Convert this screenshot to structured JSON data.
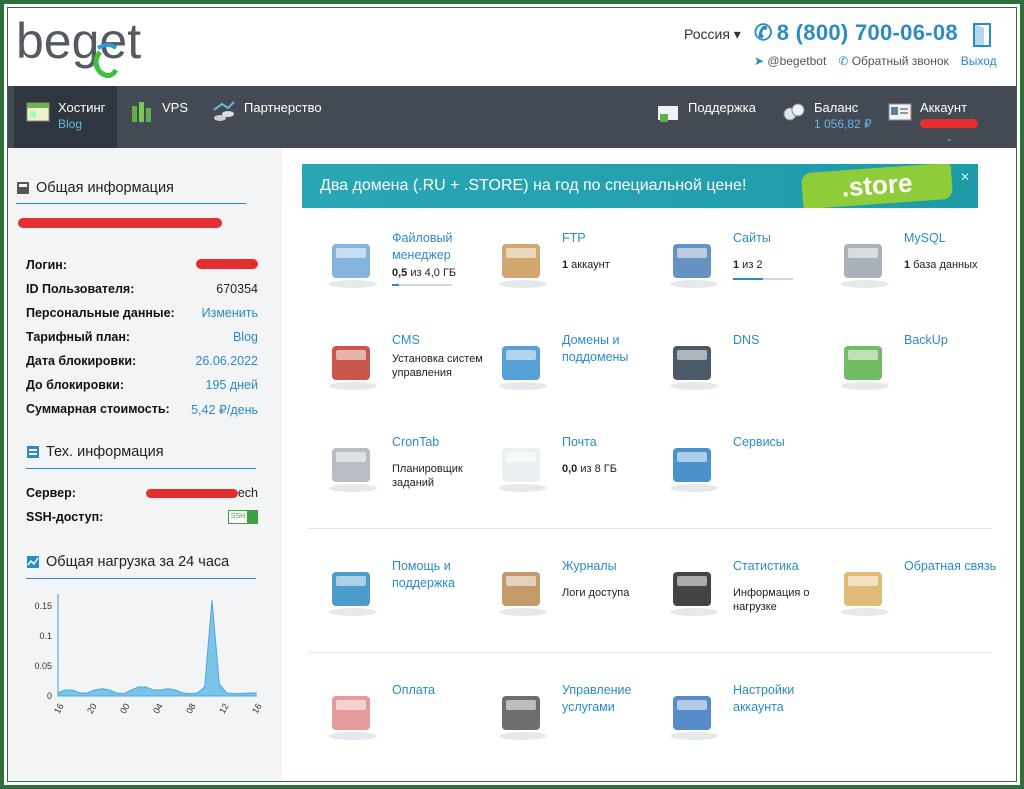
{
  "header": {
    "logo_text": "beget",
    "region": "Россия ▾",
    "phone": "8 (800) 700-06-08",
    "telegram": "@begetbot",
    "callback": "Обратный звонок",
    "exit": "Выход"
  },
  "nav": {
    "hosting": "Хостинг",
    "hosting_sub": "Blog",
    "vps": "VPS",
    "partner": "Партнерство",
    "support": "Поддержка",
    "balance": "Баланс",
    "balance_value": "1 056,82 ₽",
    "account": "Аккаунт"
  },
  "sidebar": {
    "general_title": "Общая информация",
    "rows": [
      {
        "k": "Логин:",
        "v": ""
      },
      {
        "k": "ID Пользователя:",
        "v": "670354"
      },
      {
        "k": "Персональные данные:",
        "v": "Изменить"
      },
      {
        "k": "Тарифный план:",
        "v": "Blog"
      },
      {
        "k": "Дата блокировки:",
        "v": "26.06.2022"
      },
      {
        "k": "До блокировки:",
        "v": "195 дней"
      },
      {
        "k": "Суммарная стоимость:",
        "v": "5,42 ₽/день"
      }
    ],
    "tech_title": "Тех. информация",
    "server_label": "Сервер:",
    "server_suffix": "ech",
    "ssh_label": "SSH-доступ:",
    "ssh_badge": "SSH",
    "load_title": "Общая нагрузка за 24 часа"
  },
  "chart_data": {
    "type": "area",
    "title": "Общая нагрузка за 24 часа",
    "x_ticks": [
      "16",
      "20",
      "00",
      "04",
      "08",
      "12",
      "16"
    ],
    "y_ticks": [
      "0.15",
      "0.1",
      "0.05",
      "0"
    ],
    "ylim": [
      0,
      0.17
    ],
    "values": [
      0.005,
      0.01,
      0.01,
      0.005,
      0.005,
      0.01,
      0.012,
      0.01,
      0.005,
      0.004,
      0.01,
      0.015,
      0.015,
      0.01,
      0.01,
      0.012,
      0.01,
      0.005,
      0.004,
      0.005,
      0.015,
      0.16,
      0.02,
      0.005,
      0.004,
      0.004,
      0.005,
      0.005
    ],
    "color": "#7ac4e8"
  },
  "banner": {
    "text": "Два домена (.RU + .STORE) на год по специальной цене!",
    "store": ".store",
    "close": "✕"
  },
  "tiles": [
    {
      "title": "Файловый менеджер",
      "desc_bold": "0,5",
      "desc": " из 4,0 ГБ",
      "icon": "file-manager-icon"
    },
    {
      "title": "FTP",
      "desc_bold": "1",
      "desc": " аккаунт",
      "icon": "ftp-icon"
    },
    {
      "title": "Сайты",
      "desc_bold": "1",
      "desc": " из 2",
      "icon": "sites-icon"
    },
    {
      "title": "MySQL",
      "desc_bold": "1",
      "desc": " база данных",
      "icon": "mysql-icon"
    },
    {
      "title": "CMS",
      "desc_bold": "",
      "desc": "Установка систем управления",
      "icon": "cms-icon"
    },
    {
      "title": "Домены и поддомены",
      "desc_bold": "",
      "desc": "",
      "icon": "domains-icon"
    },
    {
      "title": "DNS",
      "desc_bold": "",
      "desc": "",
      "icon": "dns-icon"
    },
    {
      "title": "BackUp",
      "desc_bold": "",
      "desc": "",
      "icon": "backup-icon"
    },
    {
      "title": "CronTab",
      "desc_bold": "",
      "desc": "Планировщик заданий",
      "icon": "crontab-icon"
    },
    {
      "title": "Почта",
      "desc_bold": "0,0",
      "desc": " из 8 ГБ",
      "icon": "mail-icon"
    },
    {
      "title": "Сервисы",
      "desc_bold": "",
      "desc": "",
      "icon": "services-icon"
    },
    {
      "title": "Помощь и поддержка",
      "desc_bold": "",
      "desc": "",
      "icon": "help-icon"
    },
    {
      "title": "Журналы",
      "desc_bold": "",
      "desc": "Логи доступа",
      "icon": "logs-icon"
    },
    {
      "title": "Статистика",
      "desc_bold": "",
      "desc": "Информация о нагрузке",
      "icon": "stats-icon"
    },
    {
      "title": "Обратная связь",
      "desc_bold": "",
      "desc": "",
      "icon": "feedback-icon"
    },
    {
      "title": "Оплата",
      "desc_bold": "",
      "desc": "",
      "icon": "payment-icon"
    },
    {
      "title": "Управление услугами",
      "desc_bold": "",
      "desc": "",
      "icon": "services-manage-icon"
    },
    {
      "title": "Настройки аккаунта",
      "desc_bold": "",
      "desc": "",
      "icon": "account-settings-icon"
    }
  ],
  "usage": {
    "file_manager": 0.12,
    "sites": 0.5
  },
  "colors": {
    "accent": "#2b8bc4",
    "nav_bg": "#434a54",
    "sidebar_bg": "#f3f4f6",
    "redaction": "#e52f2f",
    "frame": "#2f6f3a"
  }
}
